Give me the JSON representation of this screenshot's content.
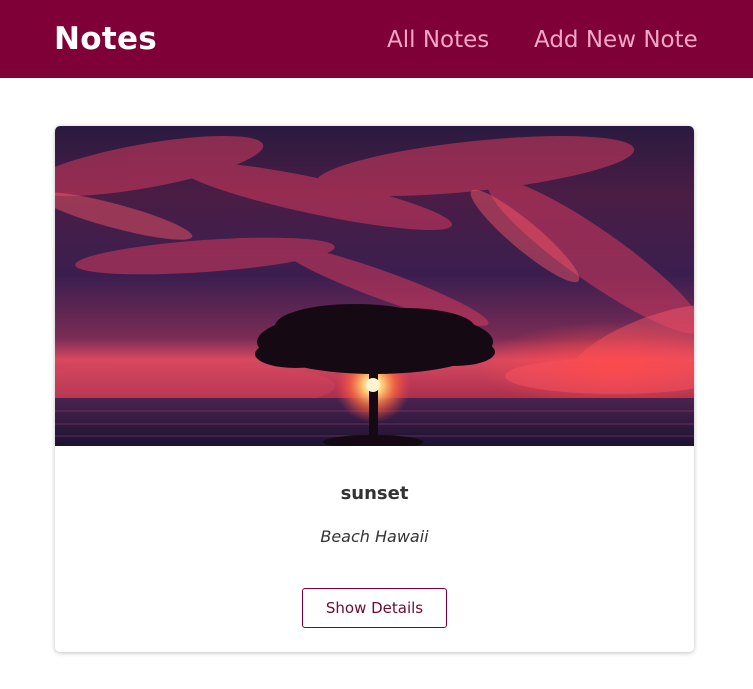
{
  "navbar": {
    "brand": "Notes",
    "links": [
      {
        "label": "All Notes"
      },
      {
        "label": "Add New Note"
      }
    ]
  },
  "note_card": {
    "title": "sunset",
    "subtitle": "Beach Hawaii",
    "button_label": "Show Details"
  },
  "colors": {
    "navbar_bg": "#7f0036",
    "nav_link": "#f3a6c6",
    "brand_text": "#ffffff",
    "button_border": "#7f0036"
  }
}
